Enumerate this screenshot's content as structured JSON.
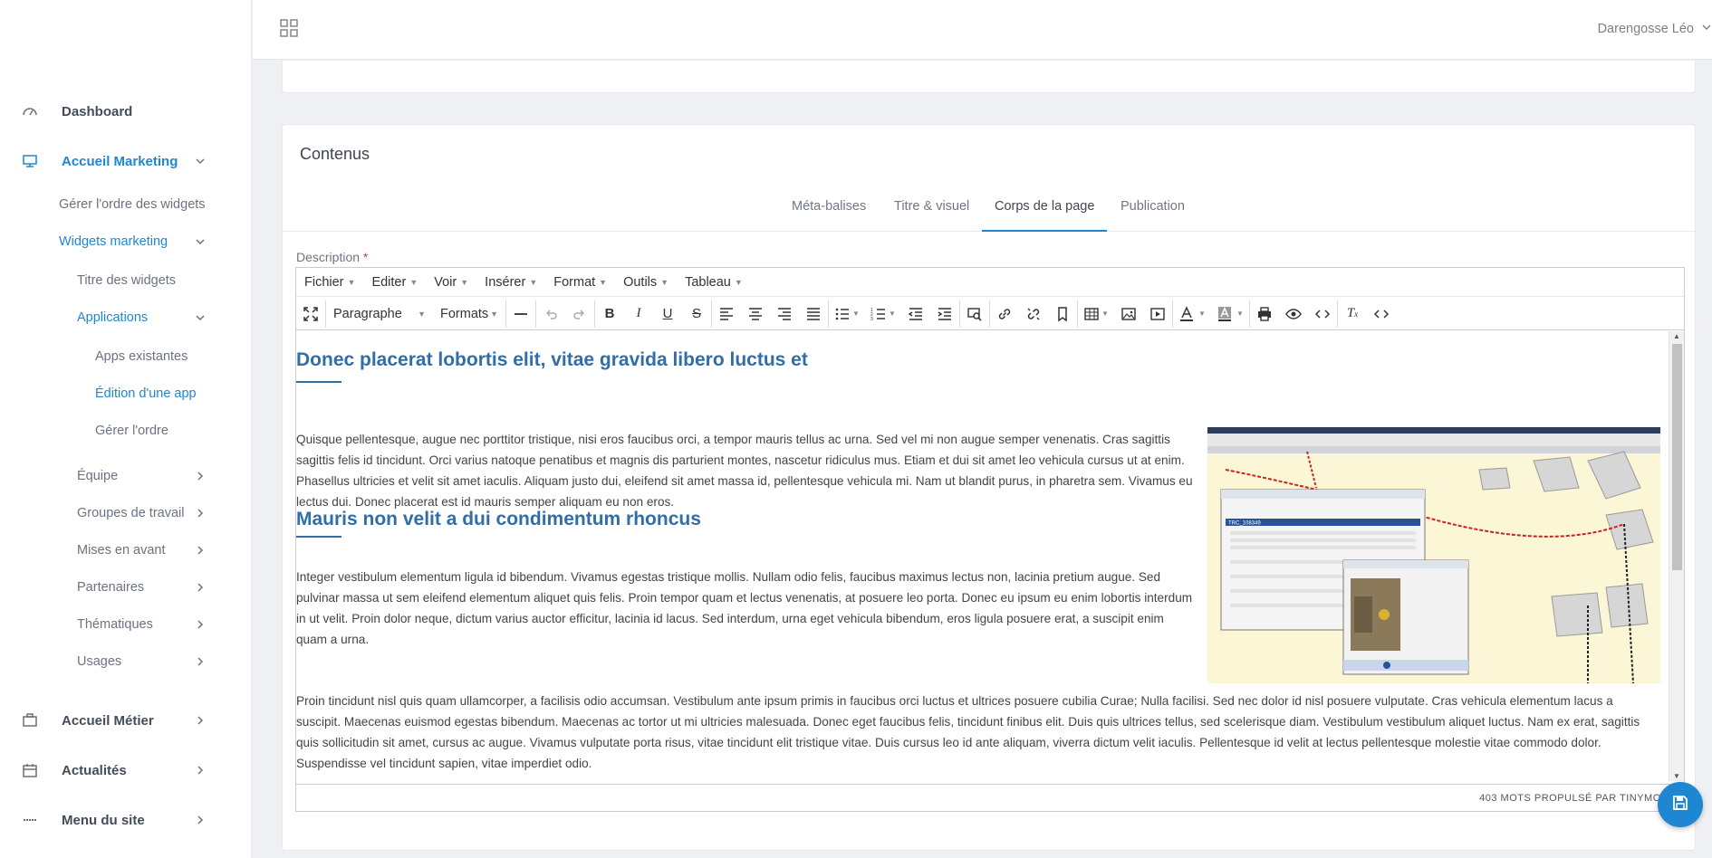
{
  "topbar": {
    "user_name": "Darengosse Léo"
  },
  "sidebar": {
    "dashboard": "Dashboard",
    "accueil_marketing": "Accueil Marketing",
    "gerer_ordre_widgets": "Gérer l'ordre des widgets",
    "widgets_marketing": "Widgets marketing",
    "titre_widgets": "Titre des widgets",
    "applications": "Applications",
    "apps_existantes": "Apps existantes",
    "edition_app": "Édition d'une app",
    "gerer_ordre": "Gérer l'ordre",
    "equipe": "Équipe",
    "groupes_travail": "Groupes de travail",
    "mises_en_avant": "Mises en avant",
    "partenaires": "Partenaires",
    "thematiques": "Thématiques",
    "usages": "Usages",
    "accueil_metier": "Accueil Métier",
    "actualites": "Actualités",
    "menu_site": "Menu du site"
  },
  "card": {
    "title": "Contenus",
    "tabs": [
      "Méta-balises",
      "Titre & visuel",
      "Corps de la page",
      "Publication"
    ],
    "description_label": "Description",
    "required_mark": "*"
  },
  "editor": {
    "menus": [
      "Fichier",
      "Editer",
      "Voir",
      "Insérer",
      "Format",
      "Outils",
      "Tableau"
    ],
    "block_format": "Paragraphe",
    "formats": "Formats",
    "heading1": "Donec placerat lobortis elit, vitae gravida libero luctus et",
    "para1": "Quisque pellentesque, augue nec porttitor tristique, nisi eros faucibus orci, a tempor mauris tellus ac urna. Sed vel mi non augue semper venenatis. Cras sagittis sagittis felis id tincidunt. Orci varius natoque penatibus et magnis dis parturient montes, nascetur ridiculus mus. Etiam et dui sit amet leo vehicula cursus ut at enim. Phasellus ultricies et velit sit amet iaculis. Aliquam justo dui, eleifend sit amet massa id, pellentesque vehicula mi. Nam ut blandit purus, in pharetra sem. Vivamus eu lectus dui. Donec placerat est id mauris semper aliquam eu non eros.",
    "heading2": "Mauris non velit a dui condimentum rhoncus",
    "para2": "Integer vestibulum elementum ligula id bibendum. Vivamus egestas tristique mollis. Nullam odio felis, faucibus maximus lectus non, lacinia pretium augue. Sed pulvinar massa ut sem eleifend elementum aliquet quis felis. Proin tempor quam et lectus venenatis, at posuere leo porta. Donec eu ipsum eu enim lobortis interdum in ut velit. Proin dolor neque, dictum varius auctor efficitur, lacinia id lacus. Sed interdum, urna eget vehicula bibendum, eros ligula posuere erat, a suscipit enim quam a urna.",
    "para3": "Proin tincidunt nisl quis quam ullamcorper, a facilisis odio accumsan. Vestibulum ante ipsum primis in faucibus orci luctus et ultrices posuere cubilia Curae; Nulla facilisi. Sed nec dolor id nisl posuere vulputate. Cras vehicula elementum lacus a suscipit. Maecenas euismod egestas bibendum. Maecenas ac tortor ut mi ultricies malesuada. Donec eget faucibus felis, tincidunt finibus elit. Duis quis ultrices tellus, sed scelerisque diam. Vestibulum vestibulum aliquet luctus. Nam ex erat, sagittis quis sollicitudin sit amet, cursus ac augue. Vivamus vulputate porta risus, vitae tincidunt elit tristique vitae. Duis cursus leo id ante aliquam, viverra dictum velit iaculis. Pellentesque id velit at lectus pellentesque molestie vitae commodo dolor. Suspendisse vel tincidunt sapien, vitae imperdiet odio.",
    "image_record_id": "TRC_108349",
    "status": "403 MOTS PROPULSÉ PAR TINYMCE"
  },
  "colors": {
    "accent": "#1f86d2",
    "heading": "#2f6ea8"
  }
}
